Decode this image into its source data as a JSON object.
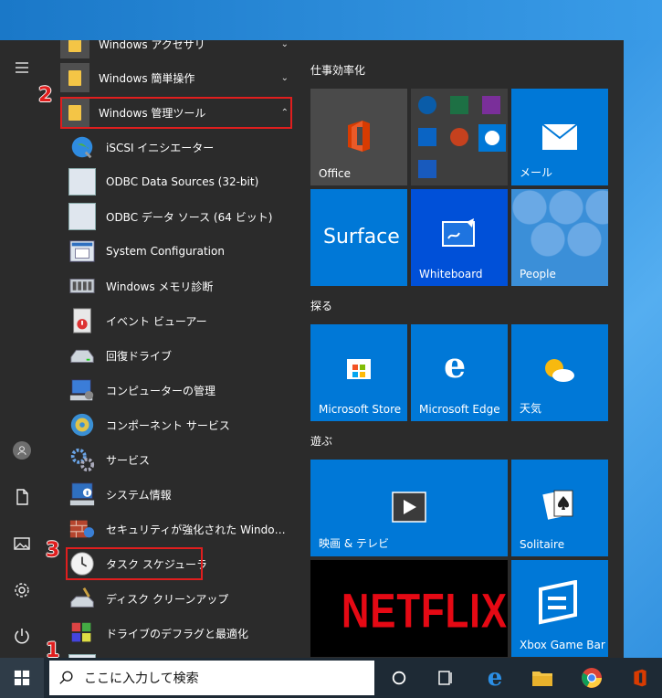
{
  "start_menu": {
    "apps": [
      {
        "label": "Windows アクセサリ",
        "type": "folder",
        "expanded": false
      },
      {
        "label": "Windows 簡単操作",
        "type": "folder",
        "expanded": false
      },
      {
        "label": "Windows 管理ツール",
        "type": "folder",
        "expanded": true
      },
      {
        "label": "iSCSI イニシエーター",
        "type": "app",
        "icon": "globe-icon"
      },
      {
        "label": "ODBC Data Sources (32-bit)",
        "type": "app",
        "icon": "odbc-icon"
      },
      {
        "label": "ODBC データ ソース (64 ビット)",
        "type": "app",
        "icon": "odbc-icon"
      },
      {
        "label": "System Configuration",
        "type": "app",
        "icon": "sysconfig-icon"
      },
      {
        "label": "Windows メモリ診断",
        "type": "app",
        "icon": "memory-icon"
      },
      {
        "label": "イベント ビューアー",
        "type": "app",
        "icon": "event-viewer-icon"
      },
      {
        "label": "回復ドライブ",
        "type": "app",
        "icon": "drive-icon"
      },
      {
        "label": "コンピューターの管理",
        "type": "app",
        "icon": "computer-management-icon"
      },
      {
        "label": "コンポーネント サービス",
        "type": "app",
        "icon": "component-services-icon"
      },
      {
        "label": "サービス",
        "type": "app",
        "icon": "services-gear-icon"
      },
      {
        "label": "システム情報",
        "type": "app",
        "icon": "system-info-icon"
      },
      {
        "label": "セキュリティが強化された Windows De...",
        "type": "app",
        "icon": "firewall-icon"
      },
      {
        "label": "タスク スケジューラ",
        "type": "app",
        "icon": "clock-icon"
      },
      {
        "label": "ディスク クリーンアップ",
        "type": "app",
        "icon": "disk-cleanup-icon"
      },
      {
        "label": "ドライブのデフラグと最適化",
        "type": "app",
        "icon": "defrag-icon"
      }
    ],
    "groups": [
      {
        "label": "仕事効率化"
      },
      {
        "label": "探る"
      },
      {
        "label": "遊ぶ"
      }
    ],
    "tiles": {
      "office": "Office",
      "mail": "メール",
      "surface": "Surface",
      "whiteboard": "Whiteboard",
      "people": "People",
      "store": "Microsoft Store",
      "edge": "Microsoft Edge",
      "weather": "天気",
      "movies": "映画 & テレビ",
      "solitaire": "Solitaire",
      "netflix": "NETFLIX",
      "xbox": "Xbox Game Bar"
    }
  },
  "steps": [
    "1",
    "2",
    "3"
  ],
  "taskbar": {
    "search_text": "ここに入力して検索"
  },
  "colors": {
    "tile_blue": "#0078d7",
    "highlight": "#e01e1e",
    "netflix_red": "#e50914"
  }
}
